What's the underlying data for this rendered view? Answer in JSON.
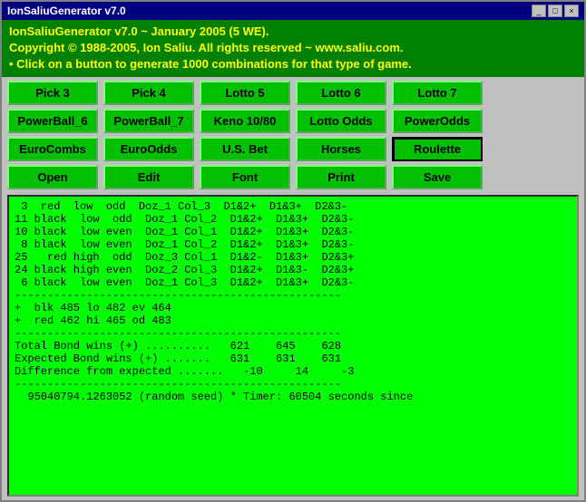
{
  "titleBar": {
    "title": "IonSaliuGenerator v7.0"
  },
  "header": {
    "line1": "IonSaliuGenerator v7.0 ~ January 2005 (5 WE).",
    "line2": "Copyright © 1988-2005, Ion Saliu. All rights reserved ~ www.saliu.com.",
    "line3": "• Click on a button to generate 1000 combinations for that type of game."
  },
  "rows": [
    {
      "buttons": [
        {
          "label": "Pick 3",
          "name": "pick3-button"
        },
        {
          "label": "Pick 4",
          "name": "pick4-button"
        },
        {
          "label": "Lotto 5",
          "name": "lotto5-button"
        },
        {
          "label": "Lotto 6",
          "name": "lotto6-button"
        },
        {
          "label": "Lotto 7",
          "name": "lotto7-button"
        }
      ]
    },
    {
      "buttons": [
        {
          "label": "PowerBall_6",
          "name": "powerball6-button"
        },
        {
          "label": "PowerBall_7",
          "name": "powerball7-button"
        },
        {
          "label": "Keno 10/80",
          "name": "keno-button"
        },
        {
          "label": "Lotto Odds",
          "name": "lotto-odds-button"
        },
        {
          "label": "PowerOdds",
          "name": "power-odds-button"
        }
      ]
    },
    {
      "buttons": [
        {
          "label": "EuroCombs",
          "name": "euro-combs-button"
        },
        {
          "label": "EuroOdds",
          "name": "euro-odds-button"
        },
        {
          "label": "U.S. Bet",
          "name": "us-bet-button"
        },
        {
          "label": "Horses",
          "name": "horses-button"
        },
        {
          "label": "Roulette",
          "name": "roulette-button",
          "selected": true
        }
      ]
    },
    {
      "buttons": [
        {
          "label": "Open",
          "name": "open-button"
        },
        {
          "label": "Edit",
          "name": "edit-button"
        },
        {
          "label": "Font",
          "name": "font-button"
        },
        {
          "label": "Print",
          "name": "print-button"
        },
        {
          "label": "Save",
          "name": "save-button"
        }
      ]
    }
  ],
  "output": {
    "content": " 3  red  low  odd  Doz_1 Col_3  D1&2+  D1&3+  D2&3-\n11 black  low  odd  Doz_1 Col_2  D1&2+  D1&3+  D2&3-\n10 black  low even  Doz_1 Col_1  D1&2+  D1&3+  D2&3-\n 8 black  low even  Doz_1 Col_2  D1&2+  D1&3+  D2&3-\n25   red high  odd  Doz_3 Col_1  D1&2-  D1&3+  D2&3+\n24 black high even  Doz_2 Col_3  D1&2+  D1&3-  D2&3+\n 6 black  low even  Doz_1 Col_3  D1&2+  D1&3+  D2&3-\n--------------------------------------------------\n+  blk 485 lo 482 ev 464\n+  red 462 hi 465 od 483\n--------------------------------------------------\nTotal Bond wins (+) ..........   621    645    628\nExpected Bond wins (+) .......   631    631    631\nDifference from expected .......   -10     14     -3\n--------------------------------------------------\n  95040794.1263052 (random seed) * Timer: 60504 seconds since"
  }
}
